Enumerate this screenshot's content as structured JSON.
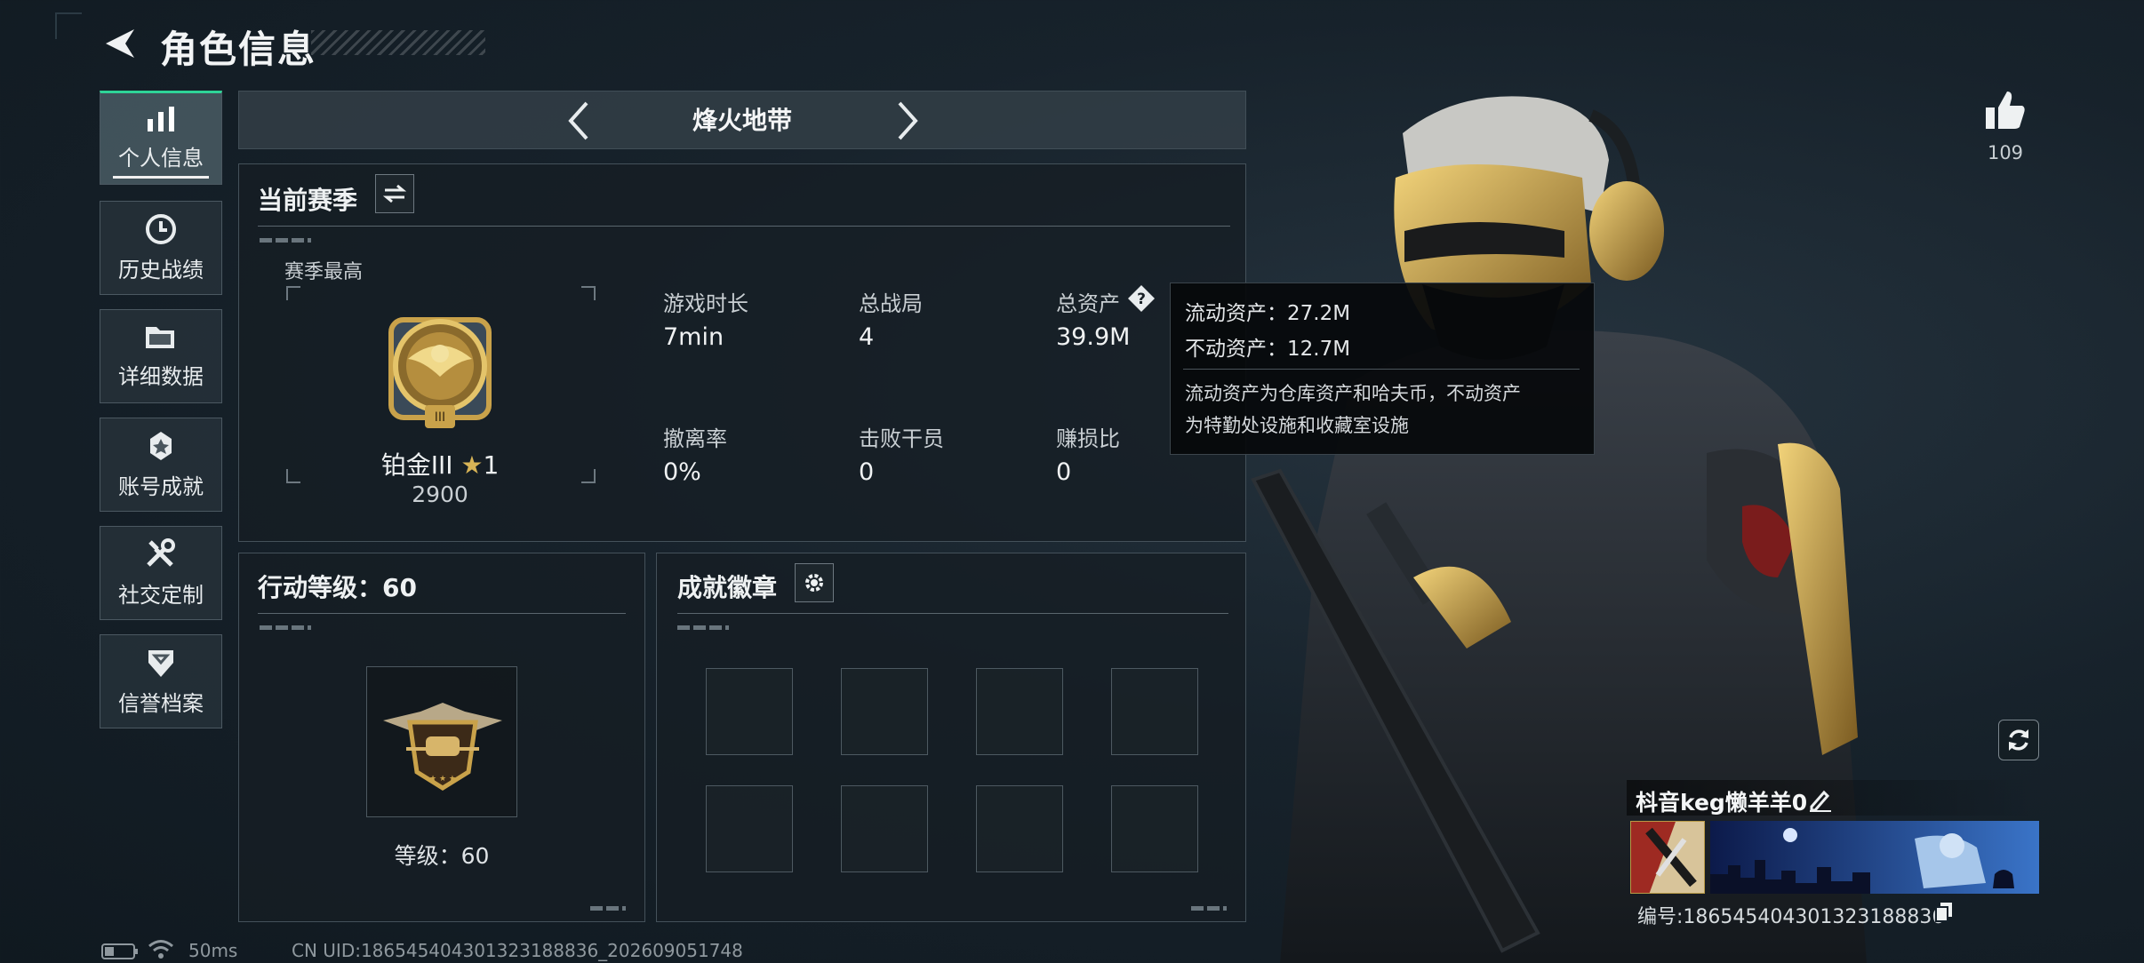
{
  "header": {
    "title": "角色信息"
  },
  "sidebar": {
    "items": [
      {
        "label": "个人信息",
        "icon": "bar-chart-icon",
        "active": true
      },
      {
        "label": "历史战绩",
        "icon": "clock-icon",
        "active": false
      },
      {
        "label": "详细数据",
        "icon": "folder-icon",
        "active": false
      },
      {
        "label": "账号成就",
        "icon": "achievement-icon",
        "active": false
      },
      {
        "label": "社交定制",
        "icon": "tools-icon",
        "active": false
      },
      {
        "label": "信誉档案",
        "icon": "badge-icon",
        "active": false
      }
    ]
  },
  "mode_nav": {
    "title": "烽火地带"
  },
  "season": {
    "title": "当前赛季",
    "best_label": "赛季最高",
    "rank_name": "铂金III",
    "rank_stars": "1",
    "rank_score": "2900",
    "stats": [
      {
        "label": "游戏时长",
        "value": "7min"
      },
      {
        "label": "总战局",
        "value": "4"
      },
      {
        "label": "总资产",
        "value": "39.9M"
      },
      {
        "label": "撤离率",
        "value": "0%"
      },
      {
        "label": "击败干员",
        "value": "0"
      },
      {
        "label": "赚损比",
        "value": "0"
      }
    ]
  },
  "tooltip": {
    "line1": "流动资产：27.2M",
    "line2": "不动资产：12.7M",
    "desc1": "流动资产为仓库资产和哈夫币，不动资产",
    "desc2": "为特勤处设施和收藏室设施"
  },
  "action_level": {
    "title": "行动等级：60",
    "level_text": "等级：60"
  },
  "achievements": {
    "title": "成就徽章",
    "slots": 8
  },
  "profile": {
    "likes": "109",
    "name": "枓音keg懒羊羊0",
    "id_text": "编号:18654540430132318883​6"
  },
  "status": {
    "ping": "50ms",
    "uid": "CN UID:18654540430132318883​6_202609051748"
  },
  "colors": {
    "accent_green": "#2ed397",
    "panel_border": "#44515a",
    "gold": "#c9a24a"
  }
}
